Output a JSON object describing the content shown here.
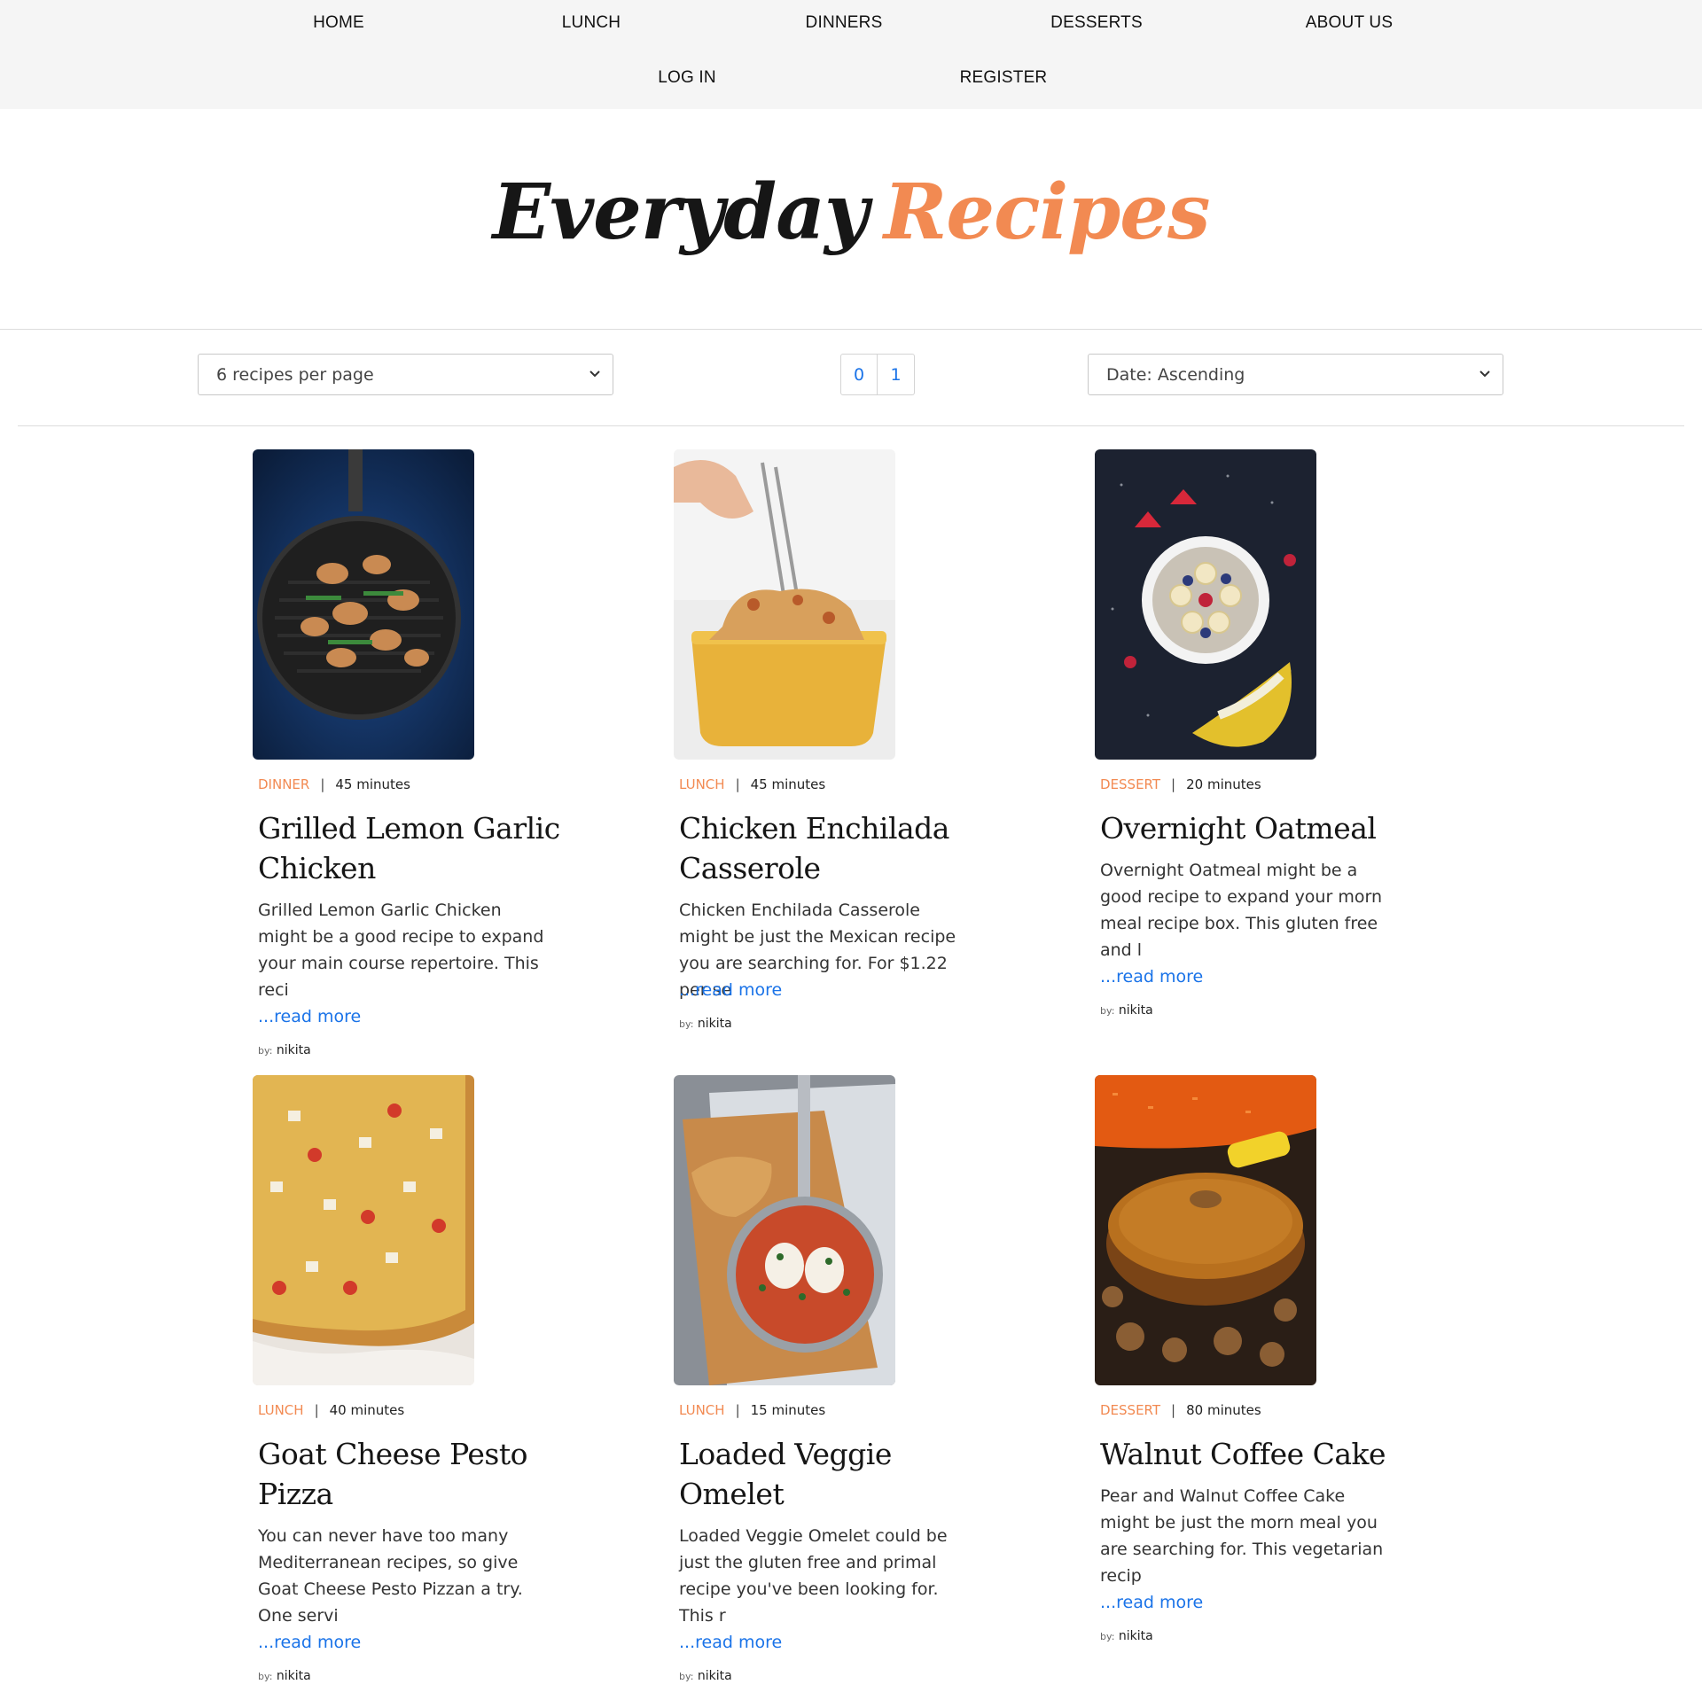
{
  "nav": {
    "row1": [
      "HOME",
      "LUNCH",
      "DINNERS",
      "DESSERTS",
      "ABOUT US"
    ],
    "row2": [
      "LOG IN",
      "REGISTER"
    ]
  },
  "site_title": {
    "first": "Everyday",
    "second": "Recipes"
  },
  "colors": {
    "accent": "#f28a52",
    "link": "#1a73e8",
    "nav_bg": "#f5f5f5"
  },
  "controls": {
    "per_page": "6 recipes per page",
    "pages": [
      "0",
      "1"
    ],
    "sort": "Date: Ascending"
  },
  "recipes": [
    {
      "category": "DINNER",
      "time": "45 minutes",
      "title": "Grilled Lemon Garlic Chicken",
      "description": "Grilled Lemon Garlic Chicken might be a good recipe to expand your main course repertoire. This reci",
      "read_more": "...read more",
      "by_label": "by:",
      "author": "nikita",
      "image": "grilled-chicken-skillet-image"
    },
    {
      "category": "LUNCH",
      "time": "45 minutes",
      "title": "Chicken Enchilada Casserole",
      "description": "Chicken Enchilada Casserole might be just the Mexican recipe you are searching for. For $1.22 per se",
      "read_more": "...read more",
      "by_label": "by:",
      "author": "nikita",
      "image": "enchilada-casserole-image"
    },
    {
      "category": "DESSERT",
      "time": "20 minutes",
      "title": "Overnight Oatmeal",
      "description": "Overnight Oatmeal might be a good recipe to expand your morn meal recipe box. This gluten free and l",
      "read_more": "...read more",
      "by_label": "by:",
      "author": "nikita",
      "image": "oatmeal-bowl-image"
    },
    {
      "category": "LUNCH",
      "time": "40 minutes",
      "title": "Goat Cheese Pesto Pizza",
      "description": "You can never have too many Mediterranean recipes, so give Goat Cheese Pesto Pizzan a try. One servi",
      "read_more": "...read more",
      "by_label": "by:",
      "author": "nikita",
      "image": "pesto-pizza-image"
    },
    {
      "category": "LUNCH",
      "time": "15 minutes",
      "title": "Loaded Veggie Omelet",
      "description": "Loaded Veggie Omelet could be just the gluten free and primal recipe you've been looking for. This r",
      "read_more": "...read more",
      "by_label": "by:",
      "author": "nikita",
      "image": "veggie-omelet-pan-image"
    },
    {
      "category": "DESSERT",
      "time": "80 minutes",
      "title": "Walnut Coffee Cake",
      "description": "Pear and Walnut Coffee Cake might be just the morn meal you are searching for. This vegetarian recip",
      "read_more": "...read more",
      "by_label": "by:",
      "author": "nikita",
      "image": "walnut-cake-image"
    }
  ]
}
